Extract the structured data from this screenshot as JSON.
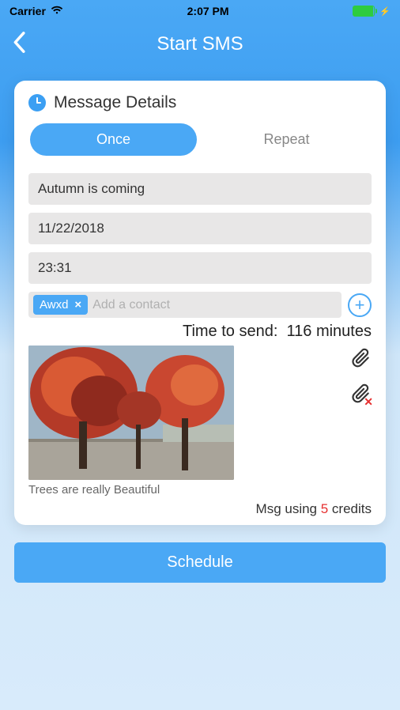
{
  "status": {
    "carrier": "Carrier",
    "time": "2:07 PM"
  },
  "nav": {
    "title": "Start SMS"
  },
  "card": {
    "section_title": "Message Details",
    "tabs": {
      "once": "Once",
      "repeat": "Repeat",
      "active": "once"
    },
    "fields": {
      "subject": "Autumn is coming",
      "date": "11/22/2018",
      "time": "23:31"
    },
    "contact": {
      "chip_label": "Awxd",
      "chip_close": "×",
      "placeholder": "Add a contact"
    },
    "time_to_send": {
      "label": "Time to send:",
      "value": "116 minutes"
    },
    "caption": "Trees are really Beautiful",
    "credits": {
      "prefix": "Msg using ",
      "count": "5",
      "suffix": " credits"
    }
  },
  "schedule_label": "Schedule"
}
